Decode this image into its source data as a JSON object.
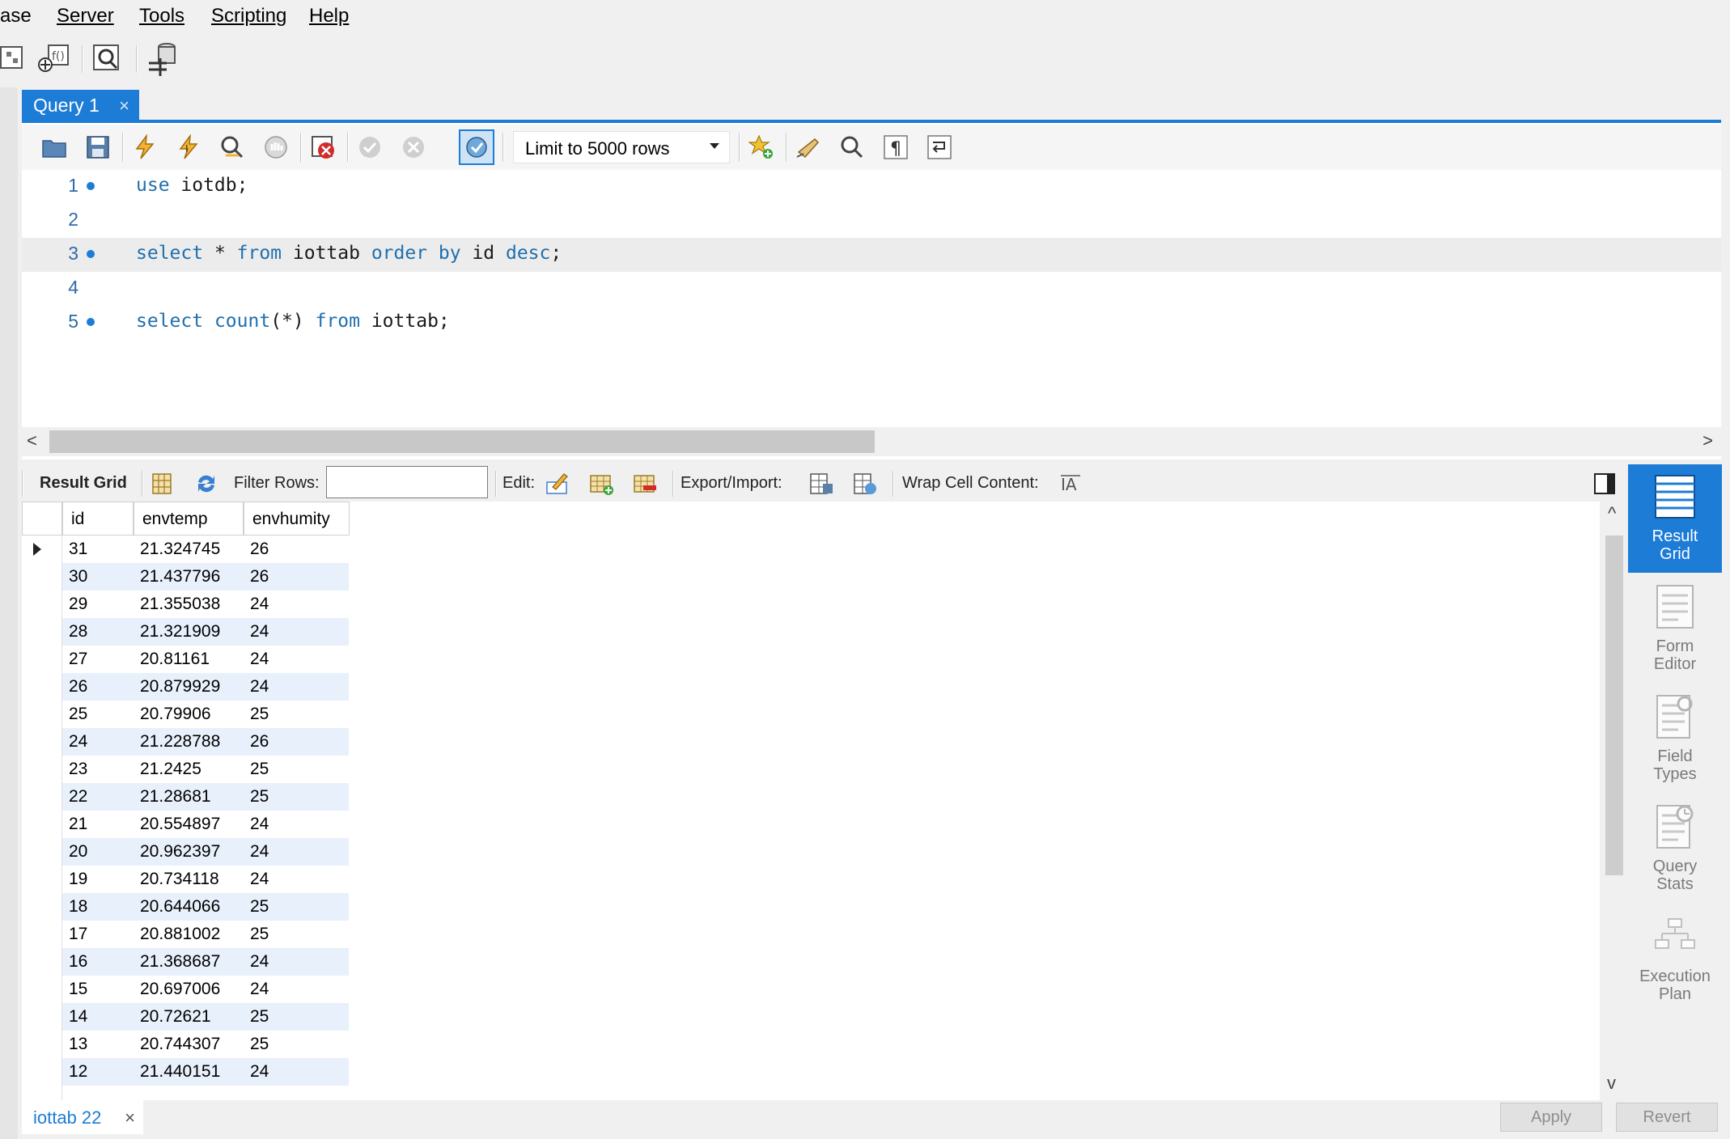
{
  "menu": [
    {
      "label": "ase"
    },
    {
      "label": "Server"
    },
    {
      "label": "Tools"
    },
    {
      "label": "Scripting"
    },
    {
      "label": "Help"
    }
  ],
  "query_tab": {
    "label": "Query 1",
    "close": "×"
  },
  "sql_toolbar": {
    "limit_label": "Limit to 5000 rows"
  },
  "code": [
    {
      "n": "1",
      "text": "use iotdb;"
    },
    {
      "n": "2",
      "text": ""
    },
    {
      "n": "3",
      "text": "select * from iottab order by id desc;"
    },
    {
      "n": "4",
      "text": ""
    },
    {
      "n": "5",
      "text": "select count(*) from iottab;"
    }
  ],
  "result_toolbar": {
    "result_grid": "Result Grid",
    "filter_rows": "Filter Rows:",
    "filter_value": "",
    "edit": "Edit:",
    "export_import": "Export/Import:",
    "wrap_cell": "Wrap Cell Content:"
  },
  "grid": {
    "columns": [
      "id",
      "envtemp",
      "envhumity"
    ],
    "rows": [
      [
        "31",
        "21.324745",
        "26"
      ],
      [
        "30",
        "21.437796",
        "26"
      ],
      [
        "29",
        "21.355038",
        "24"
      ],
      [
        "28",
        "21.321909",
        "24"
      ],
      [
        "27",
        "20.81161",
        "24"
      ],
      [
        "26",
        "20.879929",
        "24"
      ],
      [
        "25",
        "20.79906",
        "25"
      ],
      [
        "24",
        "21.228788",
        "26"
      ],
      [
        "23",
        "21.2425",
        "25"
      ],
      [
        "22",
        "21.28681",
        "25"
      ],
      [
        "21",
        "20.554897",
        "24"
      ],
      [
        "20",
        "20.962397",
        "24"
      ],
      [
        "19",
        "20.734118",
        "24"
      ],
      [
        "18",
        "20.644066",
        "25"
      ],
      [
        "17",
        "20.881002",
        "25"
      ],
      [
        "16",
        "21.368687",
        "24"
      ],
      [
        "15",
        "20.697006",
        "24"
      ],
      [
        "14",
        "20.72621",
        "25"
      ],
      [
        "13",
        "20.744307",
        "25"
      ],
      [
        "12",
        "21.440151",
        "24"
      ]
    ]
  },
  "side_panel": [
    {
      "label": "Result Grid",
      "active": true
    },
    {
      "label": "Form Editor"
    },
    {
      "label": "Field Types"
    },
    {
      "label": "Query Stats"
    },
    {
      "label": "Execution Plan"
    }
  ],
  "bottom": {
    "result_tab": "iottab 22",
    "result_tab_close": "×",
    "apply": "Apply",
    "revert": "Revert"
  },
  "colors": {
    "accent": "#1c7cd6",
    "keyword": "#1f6fae",
    "alt_row": "#e8f0fb"
  }
}
